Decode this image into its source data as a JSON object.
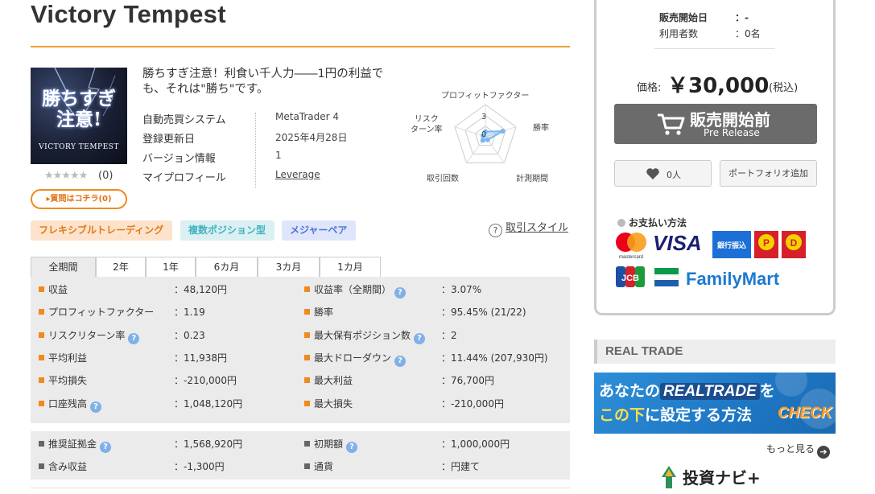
{
  "product": {
    "title": "Victory Tempest",
    "thumbnail_line1": "勝ちすぎ",
    "thumbnail_line2": "注意!",
    "thumbnail_caption": "VICTORY TEMPEST",
    "rating_stars": "★★★★★",
    "rating_count": "(0)",
    "ask_button": "▸質問はコチラ(0)",
    "tagline": "勝ちすぎ注意！利食い千人力――1円の利益でも、それは\"勝ち\"です。",
    "rating_value": 0
  },
  "info": [
    {
      "label": "自動売買システム",
      "value": "MetaTrader 4"
    },
    {
      "label": "登録更新日",
      "value": "2025年4月28日"
    },
    {
      "label": "バージョン情報",
      "value": "1"
    },
    {
      "label": "マイプロフィール",
      "value": "Leverage"
    }
  ],
  "radar": {
    "labels": {
      "top": "プロフィットファクター",
      "right": "勝率",
      "bottom_right": "計測期間",
      "bottom_left": "取引回数",
      "left": "リスク\nターン率"
    },
    "scale_labels": [
      "3",
      "0"
    ],
    "values": {
      "profit_factor": 0.8,
      "win_rate": 2.8,
      "period": 0.6,
      "trades": 0.7,
      "risk_return": 0.4
    },
    "max": 5,
    "fill_color": "#7ab6ef"
  },
  "tags": [
    "フレキシブルトレーディング",
    "複数ポジション型",
    "メジャーペア"
  ],
  "trade_style_link": "取引スタイル",
  "period_tabs": [
    "全期間",
    "2年",
    "1年",
    "6カ月",
    "3カ月",
    "1カ月"
  ],
  "active_tab": "全期間",
  "stats": {
    "left": [
      {
        "name": "収益",
        "value": "48,120円",
        "hint": false
      },
      {
        "name": "プロフィットファクター",
        "value": "1.19",
        "hint": false
      },
      {
        "name": "リスクリターン率",
        "value": "0.23",
        "hint": true
      },
      {
        "name": "平均利益",
        "value": "11,938円",
        "hint": false
      },
      {
        "name": "平均損失",
        "value": "-210,000円",
        "hint": false
      },
      {
        "name": "口座残高",
        "value": "1,048,120円",
        "hint": true
      }
    ],
    "right": [
      {
        "name": "収益率（全期間）",
        "value": "3.07%",
        "hint": true
      },
      {
        "name": "勝率",
        "value": "95.45% (21/22)",
        "hint": false
      },
      {
        "name": "最大保有ポジション数",
        "value": "2",
        "hint": true
      },
      {
        "name": "最大ドローダウン",
        "value": "11.44% (207,930円)",
        "hint": true
      },
      {
        "name": "最大利益",
        "value": "76,700円",
        "hint": false
      },
      {
        "name": "最大損失",
        "value": "-210,000円",
        "hint": false
      }
    ]
  },
  "stats2": {
    "left": [
      {
        "name": "推奨証拠金",
        "value": "1,568,920円",
        "hint": true
      },
      {
        "name": "含み収益",
        "value": "-1,300円",
        "hint": false
      }
    ],
    "right": [
      {
        "name": "初期額",
        "value": "1,000,000円",
        "hint": true
      },
      {
        "name": "通貨",
        "value": "円建て",
        "hint": false
      }
    ]
  },
  "sidebar": {
    "release_label": "販売開始日",
    "release_value": "：-",
    "users_label": "利用者数",
    "users_value": "：0名",
    "price_label": "価格:",
    "price_value": "￥30,000",
    "price_tax": "(税込)",
    "buy_button_main": "販売開始前",
    "buy_button_sub": "Pre Release",
    "fav_count": "0人",
    "portfolio_button": "ポートフォリオ追加",
    "payment_title": "お支払い方法",
    "payment_methods": [
      "mastercard",
      "VISA",
      "銀行振込",
      "ペイジー",
      "Daily",
      "JCB",
      "FamilyMart"
    ],
    "real_trade_title": "REAL TRADE",
    "banner_line1_pre": "あなたの",
    "banner_logo": "REALTRADE",
    "banner_line1_post": "を",
    "banner_line2_hl": "この下",
    "banner_line2_rest": "に設定する方法",
    "banner_check": "CHECK",
    "more_link": "もっと見る",
    "navi_title": "投資ナビ+"
  },
  "colors": {
    "accent_orange": "#f08a1c",
    "buy_button": "#6b6b6b",
    "hint_blue": "#7fb0e8",
    "stats_bg": "#ebebeb"
  }
}
